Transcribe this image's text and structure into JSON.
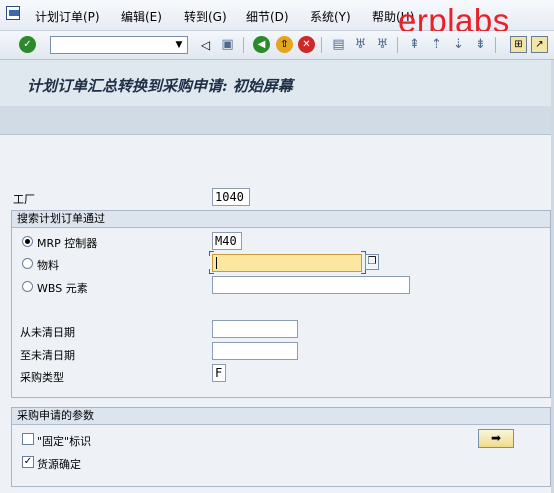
{
  "menu": {
    "items": [
      "计划订单(P)",
      "编辑(E)",
      "转到(G)",
      "细节(D)",
      "系统(Y)",
      "帮助(H)"
    ]
  },
  "watermark": "erplabs",
  "toolbar": {
    "icons": [
      "enter-icon",
      "command-field",
      "back-icon",
      "save-icon",
      "back-green-icon",
      "exit-icon",
      "cancel-icon",
      "print-icon",
      "find-icon",
      "find-next-icon",
      "first-page-icon",
      "create-session-icon",
      "shortcut-icon"
    ]
  },
  "title": "计划订单汇总转换到采购申请: 初始屏幕",
  "plant": {
    "label": "工厂",
    "value": "1040"
  },
  "search_group": {
    "title": "搜索计划订单通过",
    "mrp": {
      "label": "MRP 控制器",
      "value": "M40",
      "selected": true
    },
    "material": {
      "label": "物料",
      "value": "",
      "selected": false
    },
    "wbs": {
      "label": "WBS 元素",
      "value": "",
      "selected": false
    }
  },
  "dates": {
    "from_label": "从未清日期",
    "from_value": "",
    "to_label": "至未清日期",
    "to_value": "",
    "proc_label": "采购类型",
    "proc_value": "F"
  },
  "params_group": {
    "title": "采购申请的参数",
    "fixed": {
      "label": "\"固定\"标识",
      "checked": false
    },
    "source": {
      "label": "货源确定",
      "checked": true
    }
  },
  "colors": {
    "required": "#e0251b",
    "watermark": "#e8202a",
    "focused_field": "#fbe7a0"
  }
}
